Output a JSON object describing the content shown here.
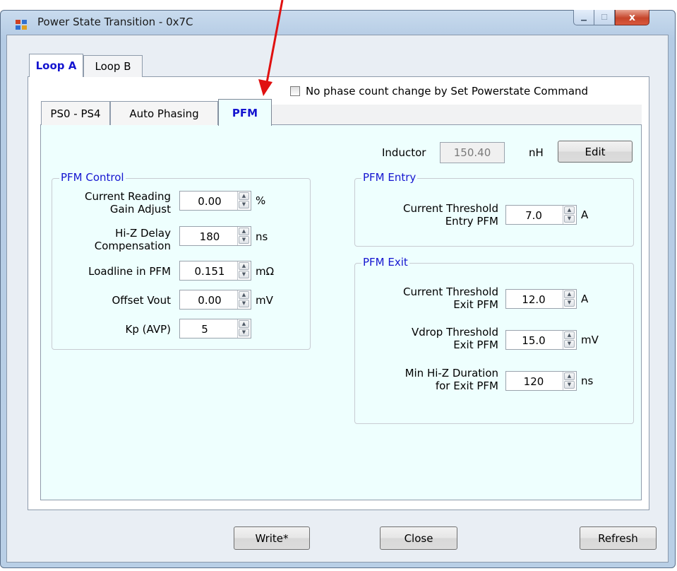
{
  "window": {
    "title": "Power State Transition - 0x7C",
    "minimize_glyph": "▁",
    "maximize_glyph": "☐",
    "close_glyph": "x"
  },
  "outer_tabs": [
    {
      "label": "Loop A",
      "selected": true
    },
    {
      "label": "Loop B",
      "selected": false
    }
  ],
  "inner_tabs": [
    {
      "label": "PS0 - PS4",
      "selected": false
    },
    {
      "label": "Auto Phasing",
      "selected": false
    },
    {
      "label": "PFM",
      "selected": true
    }
  ],
  "no_phase_checkbox": {
    "label": "No phase count change by Set Powerstate Command",
    "checked": false
  },
  "inductor": {
    "label": "Inductor",
    "value": "150.40",
    "unit": "nH",
    "edit_label": "Edit"
  },
  "pfm_control": {
    "title": "PFM Control",
    "current_reading": {
      "label_line1": "Current Reading",
      "label_line2": "Gain Adjust",
      "value": "0.00",
      "unit": "%"
    },
    "hiz_delay": {
      "label_line1": "Hi-Z Delay",
      "label_line2": "Compensation",
      "value": "180",
      "unit": "ns"
    },
    "loadline": {
      "label": "Loadline in PFM",
      "value": "0.151",
      "unit": "mΩ"
    },
    "offset_vout": {
      "label": "Offset Vout",
      "value": "0.00",
      "unit": "mV"
    },
    "kp_avp": {
      "label": "Kp (AVP)",
      "value": "5",
      "unit": ""
    }
  },
  "pfm_entry": {
    "title": "PFM Entry",
    "current_threshold": {
      "label_line1": "Current Threshold",
      "label_line2": "Entry PFM",
      "value": "7.0",
      "unit": "A"
    }
  },
  "pfm_exit": {
    "title": "PFM Exit",
    "current_threshold": {
      "label_line1": "Current Threshold",
      "label_line2": "Exit PFM",
      "value": "12.0",
      "unit": "A"
    },
    "vdrop_threshold": {
      "label_line1": "Vdrop Threshold",
      "label_line2": "Exit PFM",
      "value": "15.0",
      "unit": "mV"
    },
    "min_hiz": {
      "label_line1": "Min Hi-Z Duration",
      "label_line2": "for Exit PFM",
      "value": "120",
      "unit": "ns"
    }
  },
  "buttons": {
    "write": "Write*",
    "close": "Close",
    "refresh": "Refresh"
  },
  "colors": {
    "tab_selected_text": "#1515d0",
    "panel_bg": "#eefffe",
    "annotation_arrow": "#e01010"
  }
}
